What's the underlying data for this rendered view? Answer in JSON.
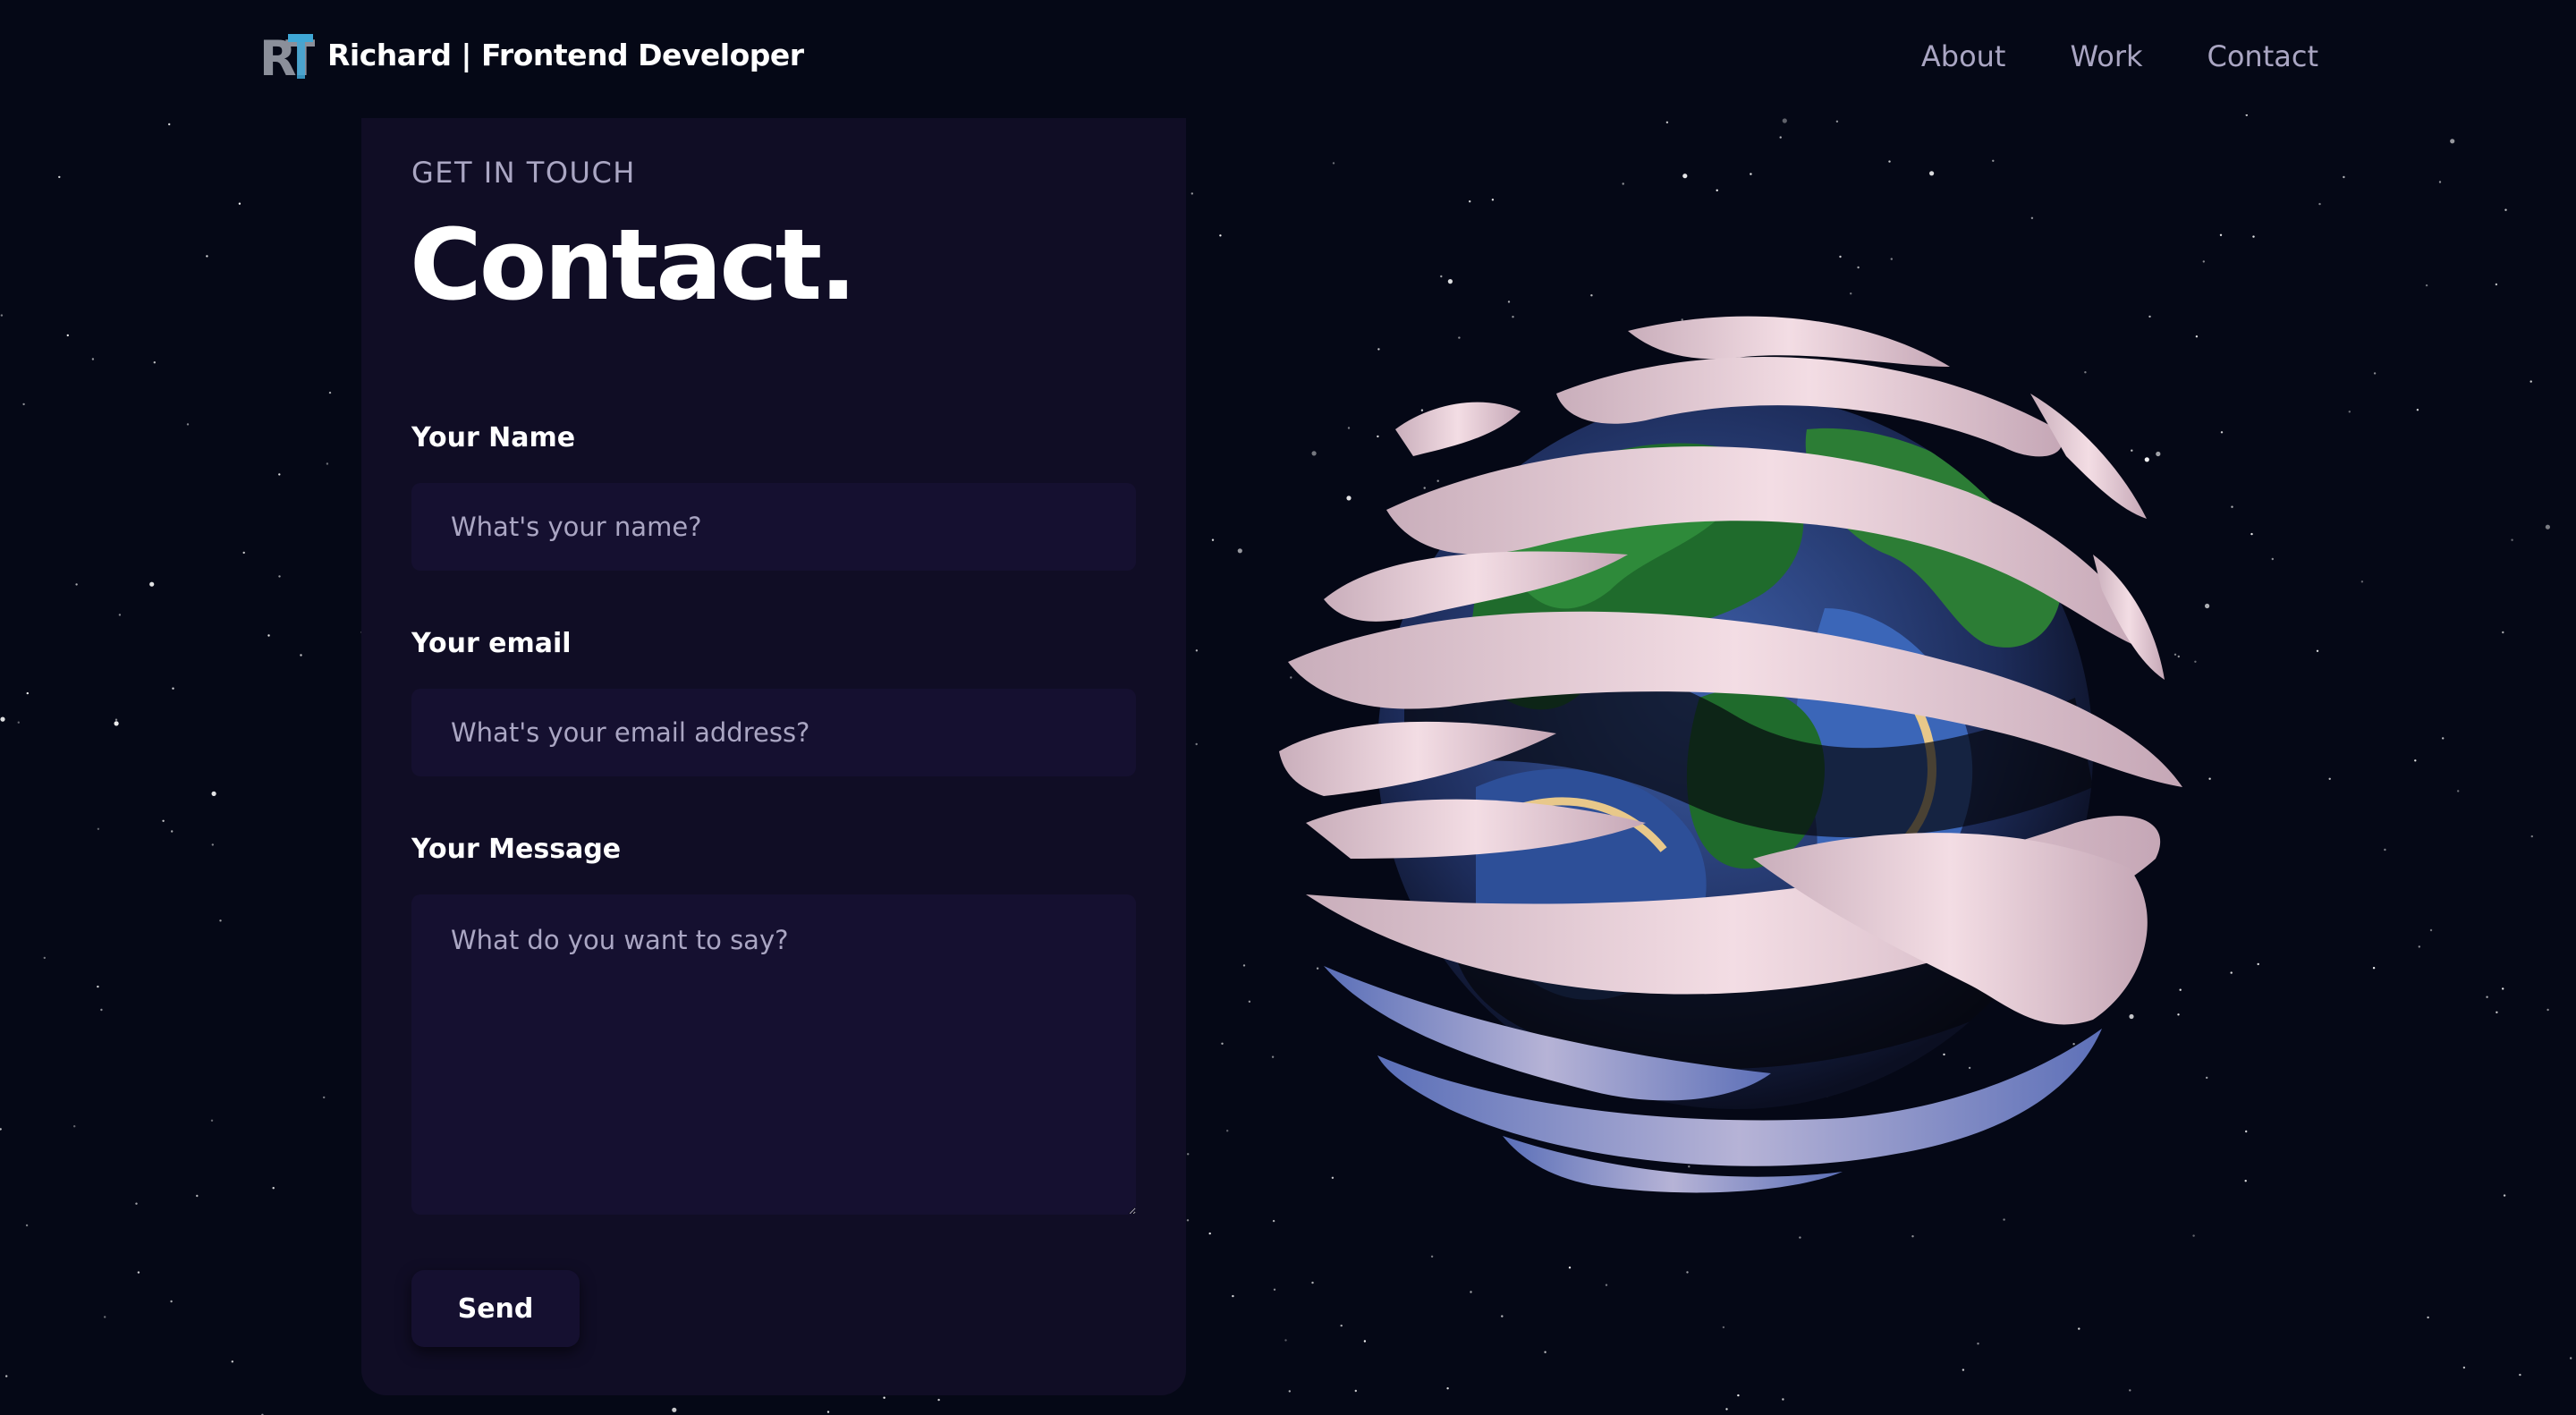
{
  "navbar": {
    "logo_text": "RT",
    "brand": "Richard | Frontend Developer",
    "links": [
      "About",
      "Work",
      "Contact"
    ]
  },
  "contact": {
    "eyebrow": "GET IN TOUCH",
    "title": "Contact.",
    "name_label": "Your Name",
    "name_placeholder": "What's your name?",
    "email_label": "Your email",
    "email_placeholder": "What's your email address?",
    "message_label": "Your Message",
    "message_placeholder": "What do you want to say?",
    "send_label": "Send"
  },
  "hero_visual": {
    "icon": "earth-globe-3d"
  },
  "colors": {
    "background": "#050816",
    "card": "#100d25",
    "input": "#151030",
    "muted_text": "#aaa6c3",
    "logo_accent": "#3fa7d6"
  }
}
